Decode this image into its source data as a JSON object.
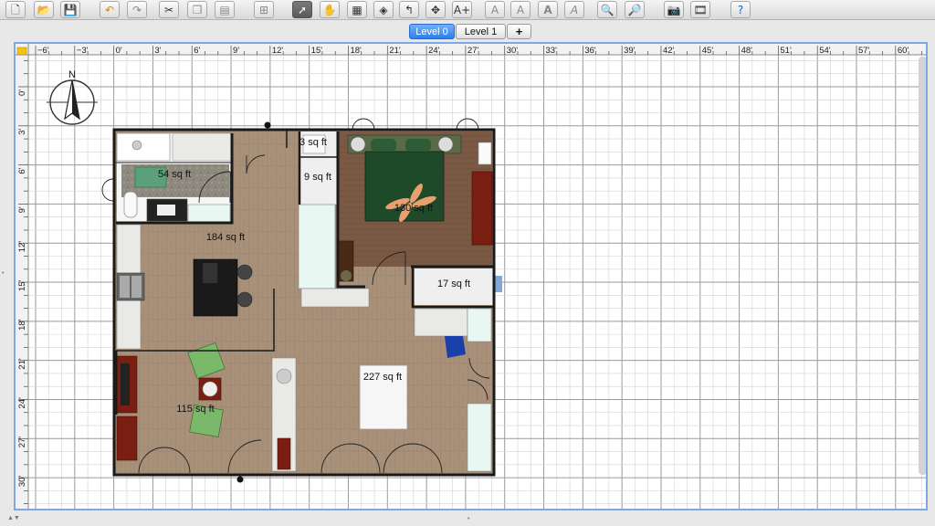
{
  "toolbar": {
    "icons": [
      "new-home-icon",
      "open-icon",
      "save-icon",
      "undo-icon",
      "redo-icon",
      "cut-icon",
      "copy-icon",
      "paste-icon",
      "add-furniture-icon",
      "select-mode-icon",
      "pan-mode-icon",
      "create-walls-icon",
      "create-rooms-icon",
      "create-polylines-icon",
      "create-dimensions-icon",
      "add-text-icon",
      "increase-text-size-icon",
      "decrease-text-size-icon",
      "bold-text-icon",
      "italic-text-icon",
      "zoom-in-icon",
      "zoom-out-icon",
      "create-photo-icon",
      "create-video-icon",
      "help-icon"
    ],
    "selected_tool": "select-mode-icon"
  },
  "levels": {
    "tabs": [
      {
        "label": "Level 0",
        "selected": true
      },
      {
        "label": "Level 1",
        "selected": false
      }
    ],
    "add_label": "+"
  },
  "ruler": {
    "top": [
      "−6'",
      "−3'",
      "0'",
      "3'",
      "6'",
      "9'",
      "12'",
      "15'",
      "18'",
      "21'",
      "24'",
      "27'",
      "30'",
      "33'",
      "36'",
      "39'",
      "42'",
      "45'",
      "48'",
      "51'",
      "54'",
      "57'",
      "60'"
    ],
    "left": [
      "0'",
      "3'",
      "6'",
      "9'",
      "12'",
      "15'",
      "18'",
      "21'",
      "24'",
      "27'",
      "30'"
    ]
  },
  "compass": {
    "label": "N"
  },
  "rooms": [
    {
      "label": "54 sq ft"
    },
    {
      "label": "184 sq ft"
    },
    {
      "label": "9 sq ft"
    },
    {
      "label": "3 sq ft"
    },
    {
      "label": "130 sq ft"
    },
    {
      "label": "17 sq ft"
    },
    {
      "label": "227 sq ft"
    },
    {
      "label": "115 sq ft"
    }
  ],
  "colors": {
    "accent": "#2f7fe9",
    "floor": "#a88f78",
    "wall": "#1a1a1a",
    "grid": "#b5b5b5",
    "bed": "#1f4a2a",
    "rug": "#7a1e12"
  }
}
